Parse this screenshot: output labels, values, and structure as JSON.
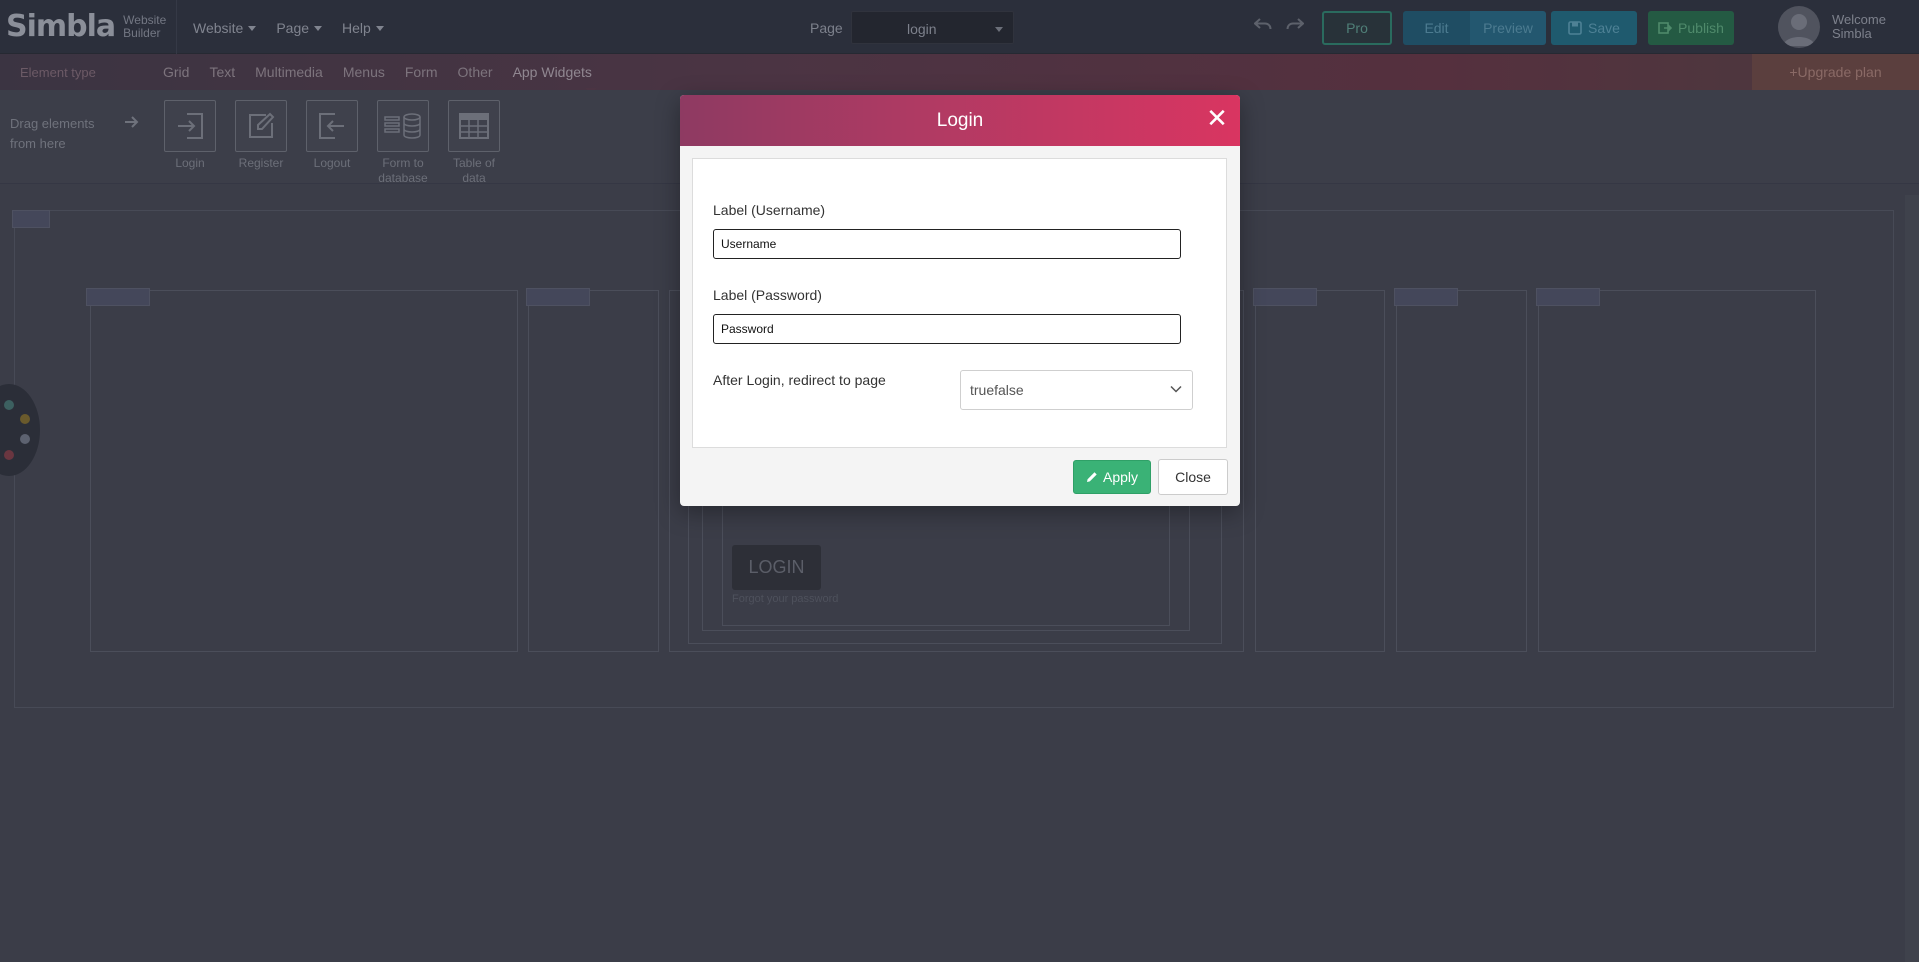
{
  "topbar": {
    "logo_text": "Simbla",
    "logo_sub_line1": "Website",
    "logo_sub_line2": "Builder",
    "menu": [
      "Website",
      "Page",
      "Help"
    ],
    "page_label": "Page",
    "page_value": "login",
    "pro_label": "Pro",
    "edit_label": "Edit",
    "preview_label": "Preview",
    "save_label": "Save",
    "publish_label": "Publish",
    "welcome_line1": "Welcome",
    "welcome_line2": "Simbla"
  },
  "element_bar": {
    "element_type_label": "Element type",
    "tabs": [
      "Grid",
      "Text",
      "Multimedia",
      "Menus",
      "Form",
      "Other",
      "App Widgets"
    ],
    "active_tab": "App Widgets",
    "upgrade_label": "+Upgrade plan"
  },
  "widget_bar": {
    "drag_hint": "Drag elements from here",
    "widgets": [
      {
        "label": "Login",
        "icon": "login-icon"
      },
      {
        "label": "Register",
        "icon": "register-icon"
      },
      {
        "label": "Logout",
        "icon": "logout-icon"
      },
      {
        "label": "Form to database",
        "icon": "database-icon"
      },
      {
        "label": "Table of data",
        "icon": "table-icon"
      }
    ]
  },
  "background": {
    "login_button": "LOGIN",
    "forgot_link": "Forgot your password"
  },
  "modal": {
    "title": "Login",
    "username_label": "Label (Username)",
    "username_value": "Username",
    "password_label": "Label (Password)",
    "password_value": "Password",
    "redirect_label": "After Login, redirect to page",
    "redirect_value": "truefalse",
    "apply_label": "Apply",
    "close_label": "Close"
  },
  "colors": {
    "modal_header_start": "#8e3a62",
    "modal_header_end": "#d93561",
    "apply_green": "#3ab276",
    "overlay_dark": "#3b3d48"
  }
}
